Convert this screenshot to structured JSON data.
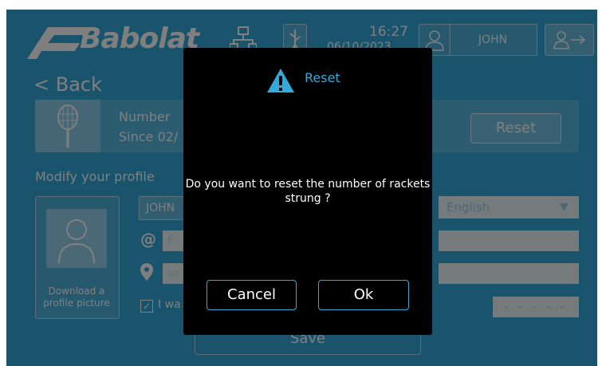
{
  "header": {
    "brand": "Babolat",
    "time": "16:27",
    "date": "06/10/2023",
    "username": "JOHN"
  },
  "nav": {
    "back_label": "< Back"
  },
  "racket_banner": {
    "count_label": "Number",
    "since_label": "Since 02/",
    "reset_label": "Reset"
  },
  "profile": {
    "section_title": "Modify your profile",
    "picture_label": "Download a profile picture",
    "name_value": "JOHN",
    "email_placeholder": "E",
    "location_value": "us",
    "checkbox_label": "I wa",
    "language_value": "English",
    "dash_value": "- - - - -",
    "save_label": "Save"
  },
  "dialog": {
    "title": "Reset",
    "message": "Do you want to reset the number of rackets strung ?",
    "cancel_label": "Cancel",
    "ok_label": "Ok"
  },
  "colors": {
    "accent": "#35a9d8",
    "dialog_bg": "#000000",
    "text": "#ffffff"
  }
}
